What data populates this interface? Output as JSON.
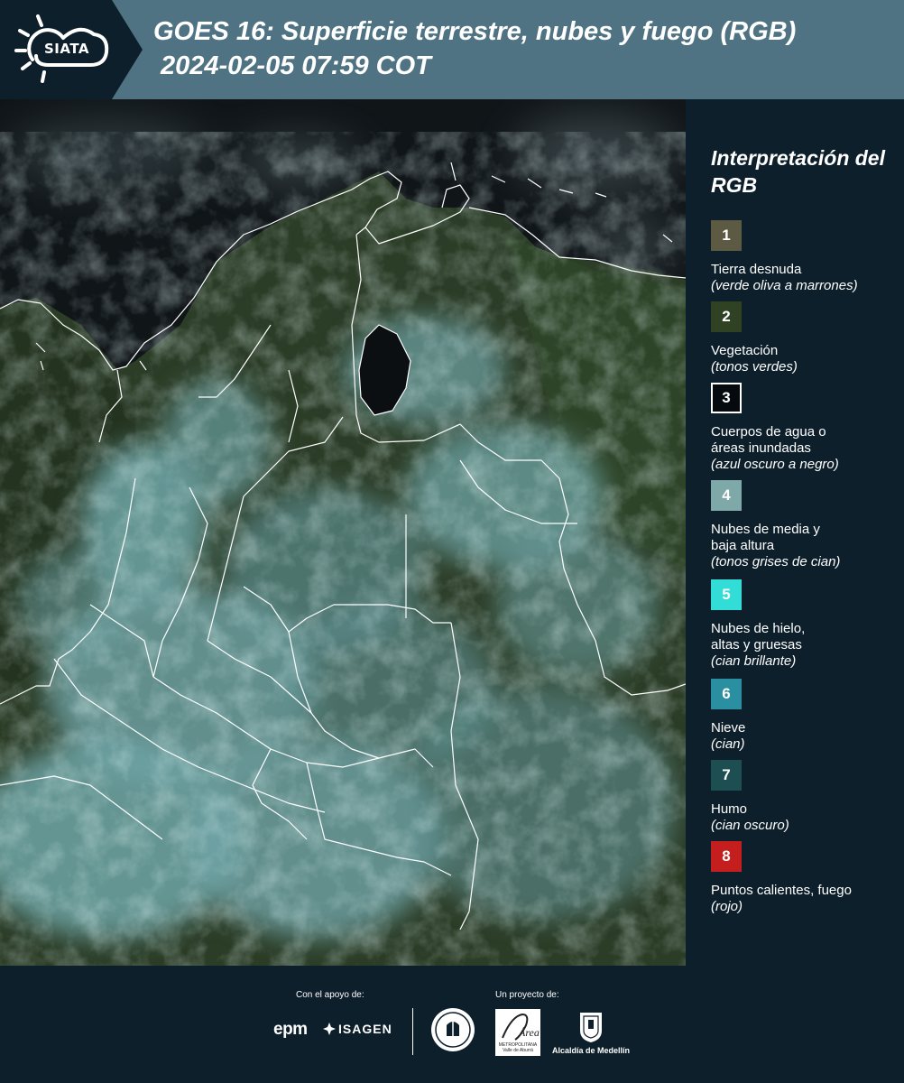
{
  "header": {
    "logo_text": "SIATA",
    "title_line1": "GOES 16: Superficie terrestre, nubes y fuego (RGB)",
    "title_line2": "2024-02-05 07:59 COT",
    "background": "#4f7383",
    "logo_background": "#0d1f2b"
  },
  "legend": {
    "title": "Interpretación del RGB",
    "items": [
      {
        "number": "1",
        "label": "Tierra desnuda",
        "note": "(verde oliva a marrones)",
        "color": "#5d5a43"
      },
      {
        "number": "2",
        "label": "Vegetación",
        "note": "(tonos verdes)",
        "color": "#2f4324"
      },
      {
        "number": "3",
        "label": "Cuerpos de agua o áreas inundadas",
        "note": "(azul oscuro a negro)",
        "color": "#050a0e"
      },
      {
        "number": "4",
        "label": "Nubes de media y baja altura",
        "note": "(tonos grises de cian)",
        "color": "#7fa8a8"
      },
      {
        "number": "5",
        "label": "Nubes de hielo, altas y gruesas",
        "note": "(cian brillante)",
        "color": "#32dcd7"
      },
      {
        "number": "6",
        "label": "Nieve",
        "note": "(cian)",
        "color": "#2a8fa0"
      },
      {
        "number": "7",
        "label": "Humo",
        "note": "(cian oscuro)",
        "color": "#1d4f52"
      },
      {
        "number": "8",
        "label": "Puntos calientes, fuego",
        "note": "(rojo)",
        "color": "#c41e1e"
      }
    ]
  },
  "footer": {
    "support_label": "Con el apoyo de:",
    "project_label": "Un proyecto de:",
    "sponsor_1": "epm",
    "sponsor_2": "ISAGEN",
    "metro_label": "METROPOLITANA Valle de Aburrá",
    "alcaldia": "Alcaldía de Medellín"
  },
  "map": {
    "land_color": "#2c3d27",
    "cloud_color": "#6fa4a6",
    "ocean_color": "#101518",
    "border_color": "#ffffff"
  }
}
